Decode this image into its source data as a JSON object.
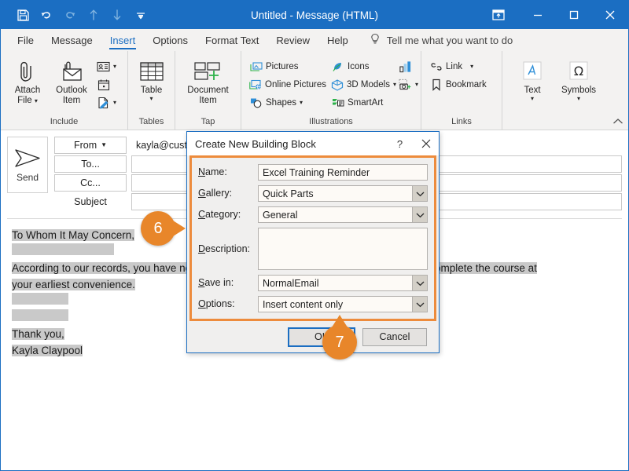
{
  "titlebar": {
    "title": "Untitled  -  Message (HTML)",
    "qat": [
      {
        "name": "save-icon",
        "label": "Save",
        "dim": false
      },
      {
        "name": "undo-icon",
        "label": "Undo",
        "dim": false
      },
      {
        "name": "redo-icon",
        "label": "Redo",
        "dim": true
      },
      {
        "name": "previous-item-icon",
        "label": "Previous Item",
        "dim": true
      },
      {
        "name": "next-item-icon",
        "label": "Next Item",
        "dim": true
      },
      {
        "name": "customize-quick-access-toolbar-icon",
        "label": "Customize Quick Access Toolbar",
        "dim": false
      }
    ],
    "window_buttons": [
      {
        "name": "ribbon-display-options-icon",
        "label": "Ribbon Display Options"
      },
      {
        "name": "minimize-icon",
        "label": "Minimize"
      },
      {
        "name": "maximize-icon",
        "label": "Maximize"
      },
      {
        "name": "close-icon",
        "label": "Close"
      }
    ]
  },
  "tabs": [
    {
      "label": "File",
      "active": false
    },
    {
      "label": "Message",
      "active": false
    },
    {
      "label": "Insert",
      "active": true
    },
    {
      "label": "Options",
      "active": false
    },
    {
      "label": "Format Text",
      "active": false
    },
    {
      "label": "Review",
      "active": false
    },
    {
      "label": "Help",
      "active": false
    }
  ],
  "tellme": {
    "label": "Tell me what you want to do",
    "icon": "lightbulb-icon"
  },
  "ribbon": {
    "groups": [
      {
        "label": "Include",
        "big": [
          {
            "label1": "Attach",
            "label2": "File",
            "caret": true,
            "icon": "paperclip-icon"
          },
          {
            "label1": "Outlook",
            "label2": "Item",
            "caret": false,
            "icon": "envelope-attach-icon"
          }
        ],
        "small": [
          {
            "label": "",
            "icon": "business-card-icon",
            "caret": true
          },
          {
            "label": "",
            "icon": "calendar-icon",
            "caret": false
          },
          {
            "label": "",
            "icon": "signature-icon",
            "caret": true
          }
        ]
      },
      {
        "label": "Tables",
        "big": [
          {
            "label1": "Table",
            "label2": "",
            "caret": true,
            "icon": "table-icon"
          }
        ],
        "small": []
      },
      {
        "label": "Tap",
        "big": [
          {
            "label1": "Document",
            "label2": "Item",
            "caret": false,
            "icon": "document-item-icon"
          }
        ],
        "small": []
      },
      {
        "label": "Illustrations",
        "big": [],
        "small": [
          {
            "label": "Pictures",
            "icon": "pictures-icon",
            "caret": false
          },
          {
            "label": "Online Pictures",
            "icon": "online-pictures-icon",
            "caret": false
          },
          {
            "label": "Shapes",
            "icon": "shapes-icon",
            "caret": true
          },
          {
            "label": "Icons",
            "icon": "icons-icon",
            "caret": false
          },
          {
            "label": "3D Models",
            "icon": "3d-models-icon",
            "caret": true
          },
          {
            "label": "SmartArt",
            "icon": "smartart-icon",
            "caret": false
          },
          {
            "label": "",
            "icon": "chart-icon",
            "caret": false
          },
          {
            "label": "",
            "icon": "screenshot-icon",
            "caret": true
          }
        ]
      },
      {
        "label": "Links",
        "big": [],
        "small": [
          {
            "label": "Link",
            "icon": "link-icon",
            "caret": true
          },
          {
            "label": "Bookmark",
            "icon": "bookmark-icon",
            "caret": false
          }
        ]
      },
      {
        "label": "",
        "big": [
          {
            "label1": "Text",
            "label2": "",
            "caret": true,
            "icon": "text-icon"
          },
          {
            "label1": "Symbols",
            "label2": "",
            "caret": true,
            "icon": "omega-icon"
          }
        ],
        "small": []
      }
    ],
    "collapse_label": "Collapse the Ribbon"
  },
  "message": {
    "send_label": "Send",
    "send_icon": "send-arrow-icon",
    "fields": [
      {
        "name": "from",
        "label": "From",
        "type": "button",
        "value": "kayla@customguide.com"
      },
      {
        "name": "to",
        "label": "To...",
        "type": "button",
        "value": ""
      },
      {
        "name": "cc",
        "label": "Cc...",
        "type": "button",
        "value": ""
      },
      {
        "name": "subject",
        "label": "Subject",
        "type": "label",
        "value": ""
      }
    ],
    "body": [
      {
        "text": "To Whom It May Concern,",
        "selected": true
      },
      {
        "text": "",
        "selected": true
      },
      {
        "text": "According to our records, you have not completed your Excel training course yet. Please complete the course at",
        "selected": true
      },
      {
        "text": "your earliest convenience.",
        "selected": true
      },
      {
        "text": "",
        "selected": true
      },
      {
        "text": "",
        "selected": true
      },
      {
        "text": "Thank you,",
        "selected": true
      },
      {
        "text": "Kayla Claypool",
        "selected": true
      }
    ]
  },
  "dialog": {
    "title": "Create New Building Block",
    "help_label": "?",
    "close_label": "✕",
    "fields": [
      {
        "key": "name",
        "label_pre": "N",
        "label_post": "ame:",
        "type": "text",
        "value": "Excel Training Reminder"
      },
      {
        "key": "gallery",
        "label_pre": "G",
        "label_post": "allery:",
        "type": "combo",
        "value": "Quick Parts"
      },
      {
        "key": "category",
        "label_pre": "C",
        "label_post": "ategory:",
        "type": "combo",
        "value": "General"
      },
      {
        "key": "description",
        "label_pre": "D",
        "label_post": "escription:",
        "type": "textarea",
        "value": ""
      },
      {
        "key": "save_in",
        "label_pre": "S",
        "label_post": "ave in:",
        "type": "combo",
        "value": "NormalEmail"
      },
      {
        "key": "options",
        "label_pre": "O",
        "label_post": "ptions:",
        "type": "combo",
        "value": "Insert content only"
      }
    ],
    "ok_label": "OK",
    "cancel_label": "Cancel",
    "highlight_color": "#ED8B3C"
  },
  "badges": [
    {
      "id": "step-6",
      "number": "6"
    },
    {
      "id": "step-7",
      "number": "7"
    }
  ]
}
